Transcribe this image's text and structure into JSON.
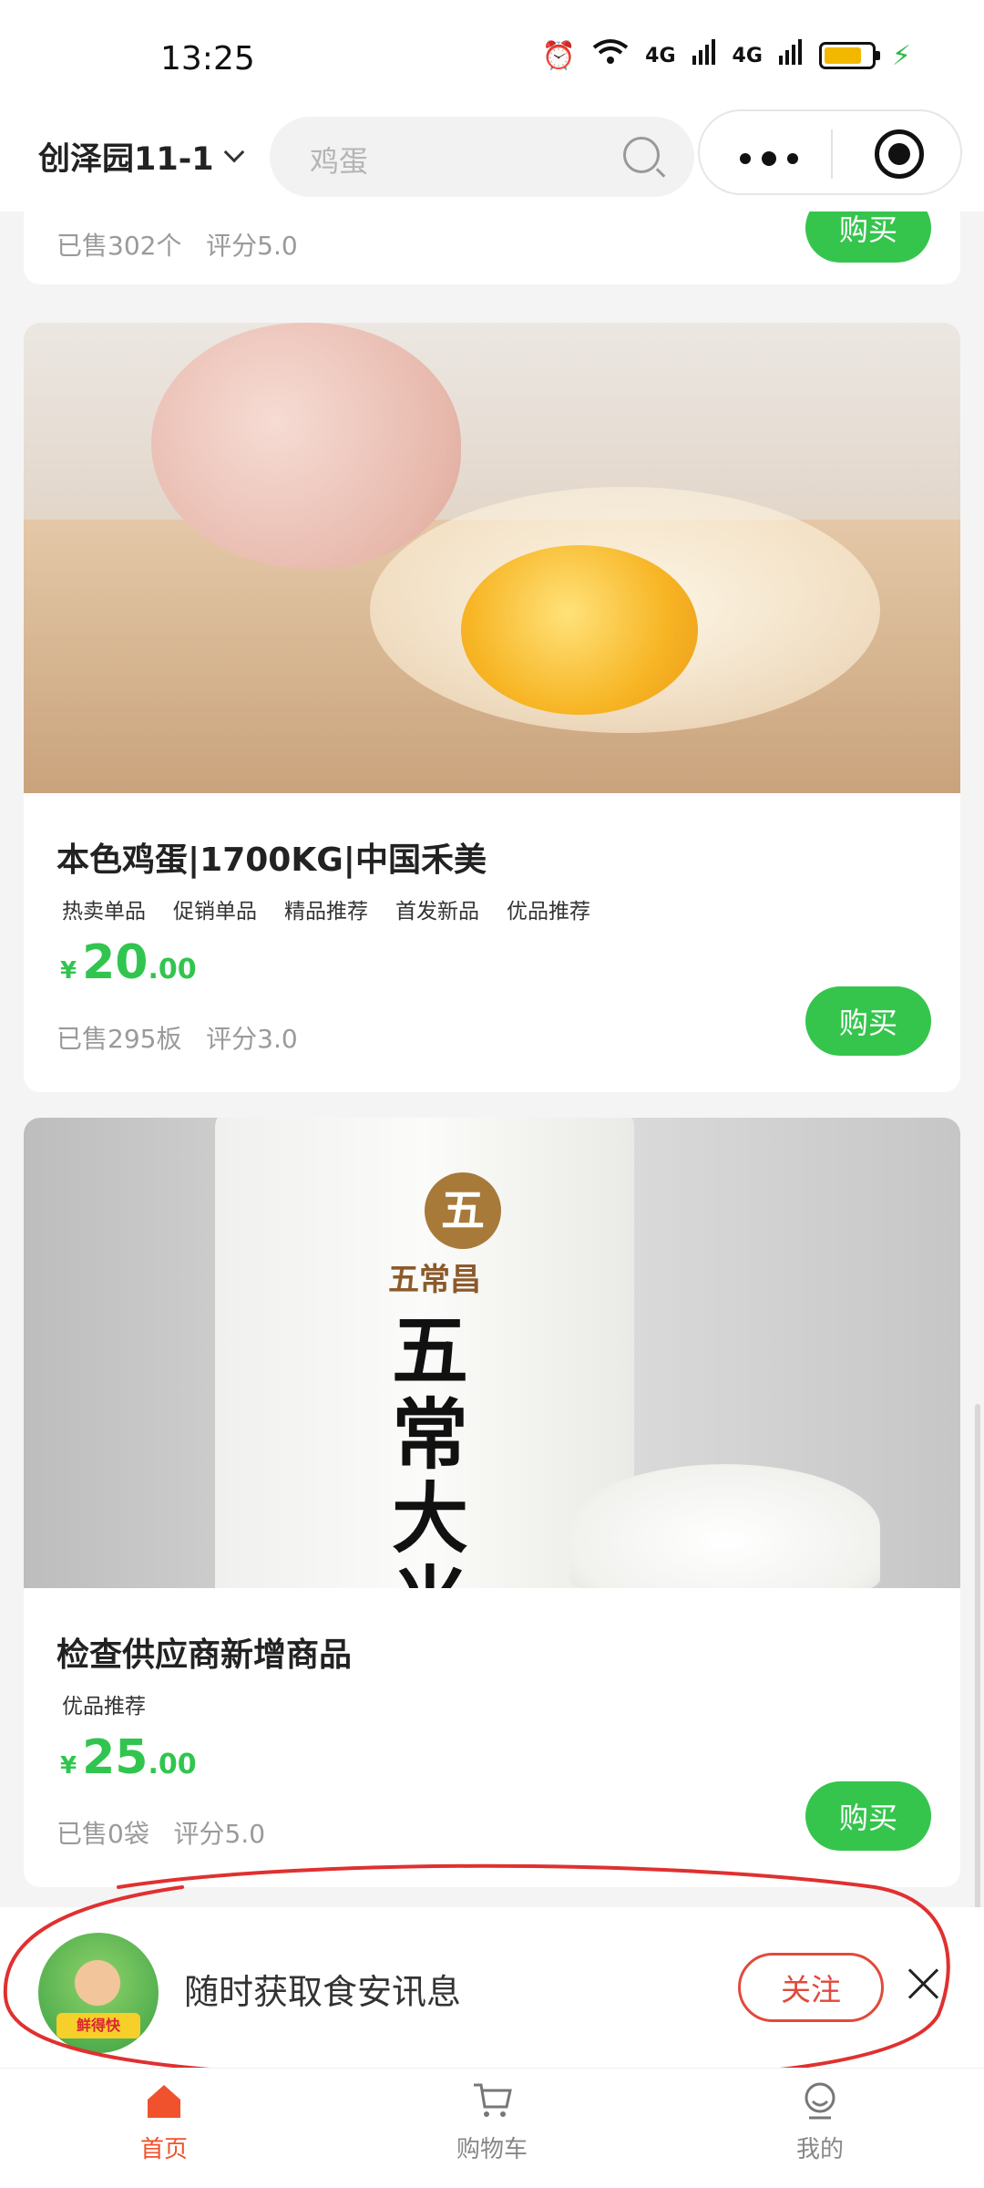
{
  "status_bar": {
    "time": "13:25",
    "signal_1": "4G",
    "signal_2": "4G",
    "battery_color": "#f2b800"
  },
  "header": {
    "location": "创泽园11-1",
    "search_placeholder": "鸡蛋"
  },
  "products": [
    {
      "sold": "已售302个",
      "rating": "评分5.0",
      "buy_label": "购买"
    },
    {
      "title": "本色鸡蛋|1700KG|中国禾美",
      "tags": [
        "热卖单品",
        "促销单品",
        "精品推荐",
        "首发新品",
        "优品推荐"
      ],
      "price_currency": "¥",
      "price_int": "20",
      "price_dec": ".00",
      "sold": "已售295板",
      "rating": "评分3.0",
      "buy_label": "购买"
    },
    {
      "title": "检查供应商新增商品",
      "tags": [
        "优品推荐"
      ],
      "price_currency": "¥",
      "price_int": "25",
      "price_dec": ".00",
      "sold": "已售0袋",
      "rating": "评分5.0",
      "buy_label": "购买",
      "bag_brand": "五常昌",
      "bag_brand_mark": "五",
      "bag_title": "五常大米"
    }
  ],
  "banner": {
    "logo_text": "鲜得快",
    "text": "随时获取食安讯息",
    "follow_label": "关注"
  },
  "tabbar": {
    "items": [
      {
        "label": "首页",
        "active": true
      },
      {
        "label": "购物车",
        "active": false
      },
      {
        "label": "我的",
        "active": false
      }
    ]
  },
  "colors": {
    "accent_green": "#35c54d",
    "price_green": "#31c54f",
    "tab_active": "#f0522d",
    "follow_red": "#e04a3b"
  }
}
